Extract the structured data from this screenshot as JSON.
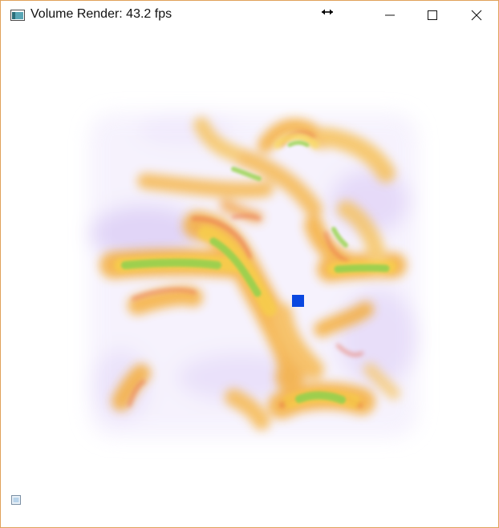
{
  "window": {
    "title": "Volume Render: 43.2 fps",
    "icons": {
      "app": "app-window-icon",
      "resize": "horizontal-resize-icon",
      "minimize": "minimize-icon",
      "maximize": "maximize-icon",
      "close": "close-icon",
      "corner": "small-window-icon"
    }
  },
  "render": {
    "colors": {
      "orange": "#f5a623",
      "yellow": "#f7d04a",
      "green": "#8fd14f",
      "red": "#e8684a",
      "lavender": "#c9b3f2",
      "marker": "#0a47e0",
      "window_border": "#e0a25a"
    }
  }
}
